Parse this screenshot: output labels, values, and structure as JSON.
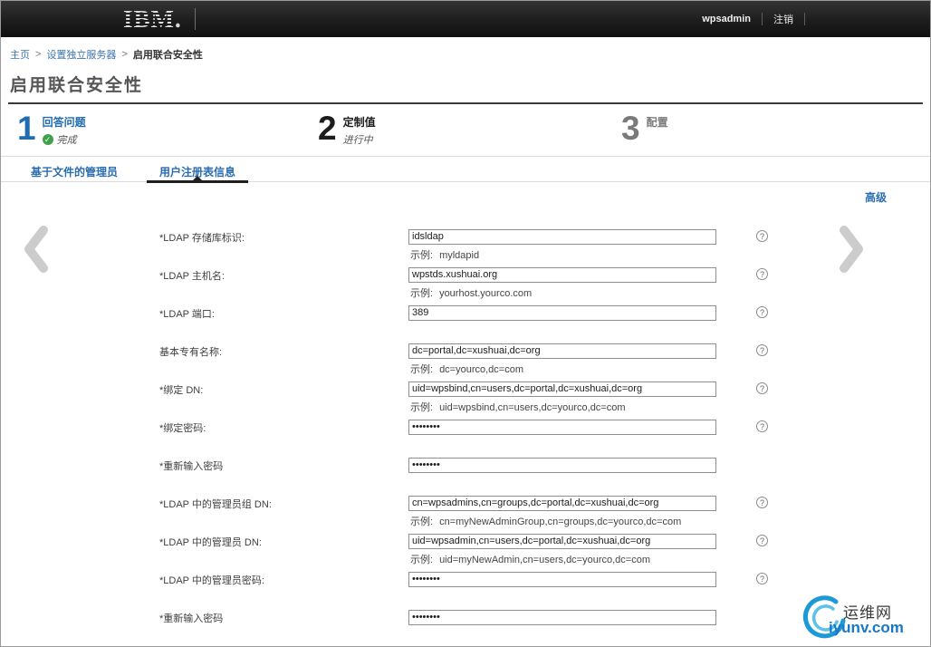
{
  "header": {
    "logo_text": "IBM",
    "logo_dot": ".",
    "user": "wpsadmin",
    "logout": "注销"
  },
  "breadcrumb": {
    "separator": ">",
    "links": [
      "主页",
      "设置独立服务器"
    ],
    "current": "启用联合安全性"
  },
  "page": {
    "title": "启用联合安全性",
    "advanced": "高级"
  },
  "wizard": {
    "steps": [
      {
        "number": "1",
        "label": "回答问题",
        "status": "完成"
      },
      {
        "number": "2",
        "label": "定制值",
        "status": "进行中"
      },
      {
        "number": "3",
        "label": "配置",
        "status": ""
      }
    ]
  },
  "tabs": [
    {
      "label": "基于文件的管理员"
    },
    {
      "label": "用户注册表信息"
    }
  ],
  "icons": {
    "check_glyph": "✓",
    "help_glyph": "?"
  },
  "form": {
    "example_prefix": "示例:",
    "fields": [
      {
        "label": "*LDAP 存储库标识:",
        "value": "idsldap",
        "example": "myldapid"
      },
      {
        "label": "*LDAP 主机名:",
        "value": "wpstds.xushuai.org",
        "example": "yourhost.yourco.com"
      },
      {
        "label": "*LDAP 端口:",
        "value": "389"
      },
      {
        "label": "基本专有名称:",
        "value": "dc=portal,dc=xushuai,dc=org",
        "example": "dc=yourco,dc=com"
      },
      {
        "label": "*绑定 DN:",
        "value": "uid=wpsbind,cn=users,dc=portal,dc=xushuai,dc=org",
        "example": "uid=wpsbind,cn=users,dc=yourco,dc=com"
      },
      {
        "label": "*绑定密码:",
        "value": "••••••••"
      },
      {
        "label": "*重新输入密码",
        "value": "••••••••"
      },
      {
        "label": "*LDAP 中的管理员组 DN:",
        "value": "cn=wpsadmins,cn=groups,dc=portal,dc=xushuai,dc=org",
        "example": "cn=myNewAdminGroup,cn=groups,dc=yourco,dc=com"
      },
      {
        "label": "*LDAP 中的管理员 DN:",
        "value": "uid=wpsadmin,cn=users,dc=portal,dc=xushuai,dc=org",
        "example": "uid=myNewAdmin,cn=users,dc=yourco,dc=com"
      },
      {
        "label": "*LDAP 中的管理员密码:",
        "value": "••••••••"
      },
      {
        "label": "*重新输入密码",
        "value": "••••••••"
      }
    ]
  },
  "watermark": {
    "line1": "运维网",
    "line2": "iyunv.com"
  }
}
